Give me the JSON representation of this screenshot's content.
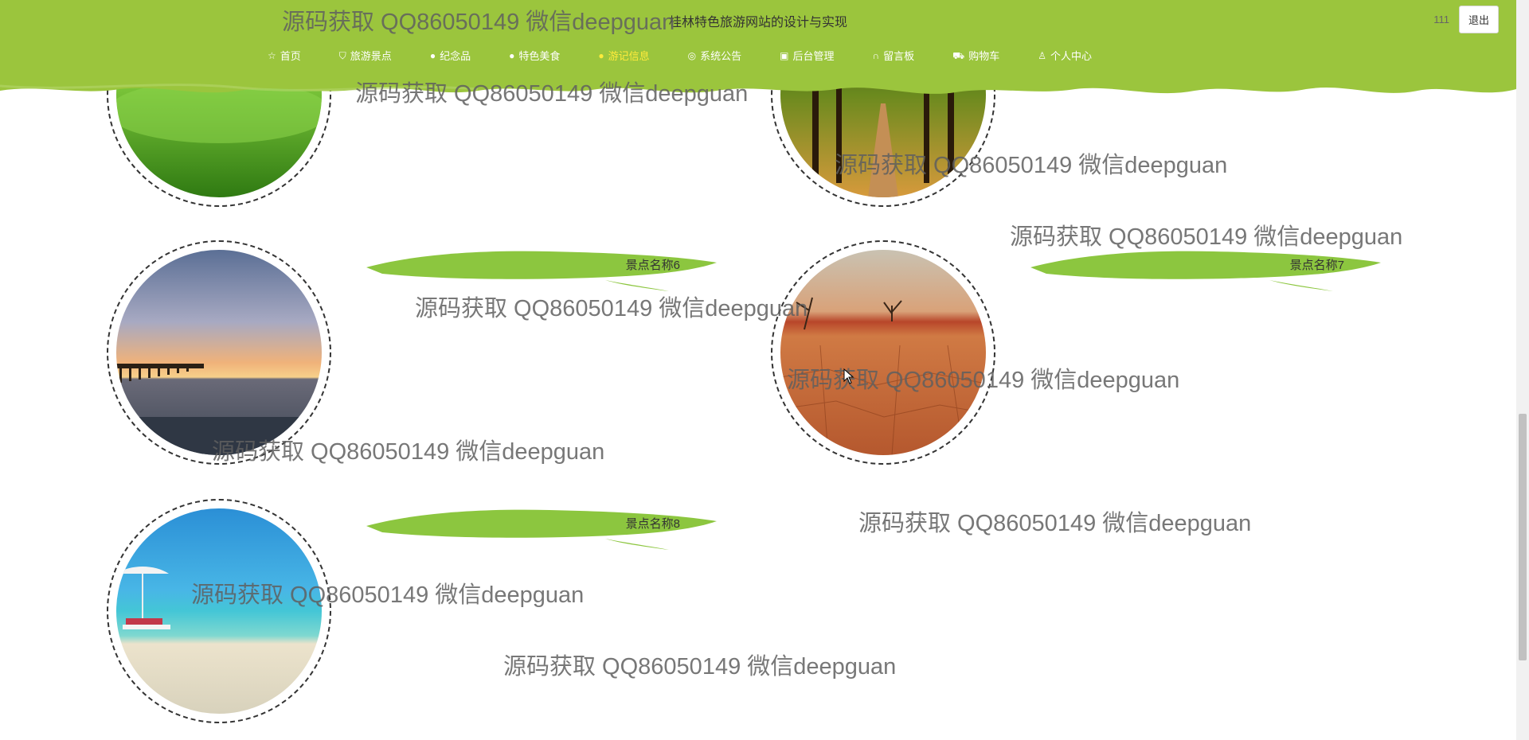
{
  "header": {
    "site_title": "桂林特色旅游网站的设计与实现",
    "username": "111",
    "logout_label": "退出",
    "bg_color": "#9bc53d"
  },
  "nav": [
    {
      "label": "首页",
      "icon": "star-icon"
    },
    {
      "label": "旅游景点",
      "icon": "bag-icon"
    },
    {
      "label": "纪念品",
      "icon": "info-circle-icon"
    },
    {
      "label": "特色美食",
      "icon": "question-circle-icon"
    },
    {
      "label": "游记信息",
      "icon": "info-circle-icon",
      "active": true
    },
    {
      "label": "系统公告",
      "icon": "globe-icon"
    },
    {
      "label": "后台管理",
      "icon": "clipboard-icon"
    },
    {
      "label": "留言板",
      "icon": "headset-icon"
    },
    {
      "label": "购物车",
      "icon": "cart-icon"
    },
    {
      "label": "个人中心",
      "icon": "user-icon"
    }
  ],
  "spots": [
    {
      "name": "景点名称6",
      "image": "sunset-pier"
    },
    {
      "name": "景点名称7",
      "image": "desert-dead-trees"
    },
    {
      "name": "景点名称8",
      "image": "beach-umbrella"
    }
  ],
  "watermark": "源码获取 QQ86050149 微信deepguan"
}
